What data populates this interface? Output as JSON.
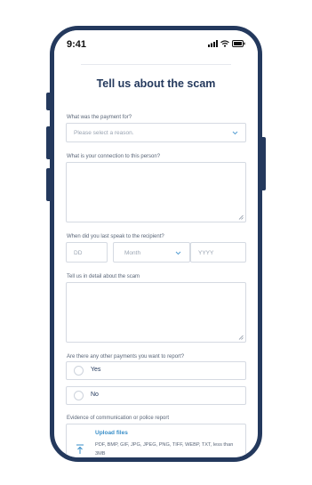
{
  "status_bar": {
    "time": "9:41"
  },
  "form": {
    "title": "Tell us about the scam",
    "payment_for": {
      "label": "What was the payment for?",
      "placeholder": "Please select a reason."
    },
    "connection": {
      "label": "What is your connection to this person?"
    },
    "last_spoke": {
      "label": "When did you last speak to the recipient?",
      "day_placeholder": "DD",
      "month_placeholder": "Month",
      "year_placeholder": "YYYY"
    },
    "details": {
      "label": "Tell us in detail about the scam"
    },
    "other_payments": {
      "label": "Are there any other payments you want to report?",
      "options": [
        "Yes",
        "No"
      ]
    },
    "evidence": {
      "label": "Evidence of communication or police report",
      "upload_title": "Upload files",
      "upload_desc": "PDF, BMP, GIF, JPG, JPEG, PNG, TIFF, WEBP, TXT, less than 3MB"
    }
  },
  "colors": {
    "frame": "#24395d",
    "title": "#24395d",
    "accent": "#3a8fc9",
    "border": "#d5dae2"
  }
}
